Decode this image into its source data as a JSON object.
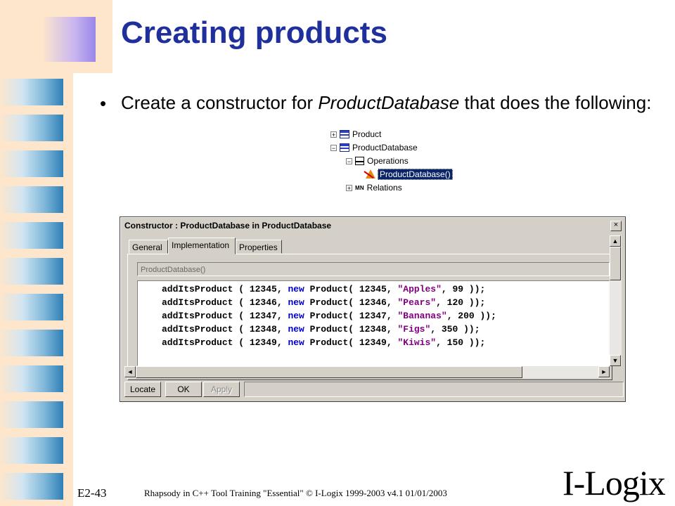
{
  "slide": {
    "title": "Creating products",
    "bullet_marker": "•",
    "bullet_pre": "Create a constructor for ",
    "bullet_italic": "ProductDatabase",
    "bullet_post": " that does the following:"
  },
  "tree": {
    "product": "Product",
    "product_database": "ProductDatabase",
    "operations": "Operations",
    "constructor": "ProductDatabase()",
    "relations_icon": "M N",
    "relations": "Relations"
  },
  "dialog": {
    "title": "Constructor : ProductDatabase in ProductDatabase",
    "close": "×",
    "tabs": {
      "general": "General",
      "implementation": "Implementation",
      "properties": "Properties"
    },
    "signature": "ProductDatabase()",
    "code_lines": [
      {
        "pre": "addItsProduct ( 12345, ",
        "kw": "new",
        "mid": " Product( 12345, ",
        "str": "\"Apples\"",
        "post": ", 99 ));"
      },
      {
        "pre": "addItsProduct ( 12346, ",
        "kw": "new",
        "mid": " Product( 12346, ",
        "str": "\"Pears\"",
        "post": ", 120 ));"
      },
      {
        "pre": "addItsProduct ( 12347, ",
        "kw": "new",
        "mid": " Product( 12347, ",
        "str": "\"Bananas\"",
        "post": ", 200 ));"
      },
      {
        "pre": "addItsProduct ( 12348, ",
        "kw": "new",
        "mid": " Product( 12348, ",
        "str": "\"Figs\"",
        "post": ", 350 ));"
      },
      {
        "pre": "addItsProduct ( 12349, ",
        "kw": "new",
        "mid": " Product( 12349, ",
        "str": "\"Kiwis\"",
        "post": ", 150 ));"
      }
    ],
    "scroll": {
      "up": "▲",
      "down": "▼",
      "left": "◄",
      "right": "►"
    },
    "buttons": {
      "locate": "Locate",
      "ok": "OK",
      "apply": "Apply"
    }
  },
  "footer": {
    "code": "E2-43",
    "text": "Rhapsody in C++ Tool Training \"Essential\"   © I-Logix 1999-2003   v4.1  01/01/2003",
    "logo": "I-Logix"
  },
  "icons": [
    "expand-icon",
    "class-icon",
    "operations-icon",
    "constructor-icon",
    "relations-icon",
    "close-icon",
    "scroll-arrow-icon"
  ],
  "colors": {
    "title": "#1f2f9c",
    "keyword": "#0000cc",
    "string": "#800080",
    "selection": "#0a246a",
    "dialog": "#d4d0c8"
  }
}
